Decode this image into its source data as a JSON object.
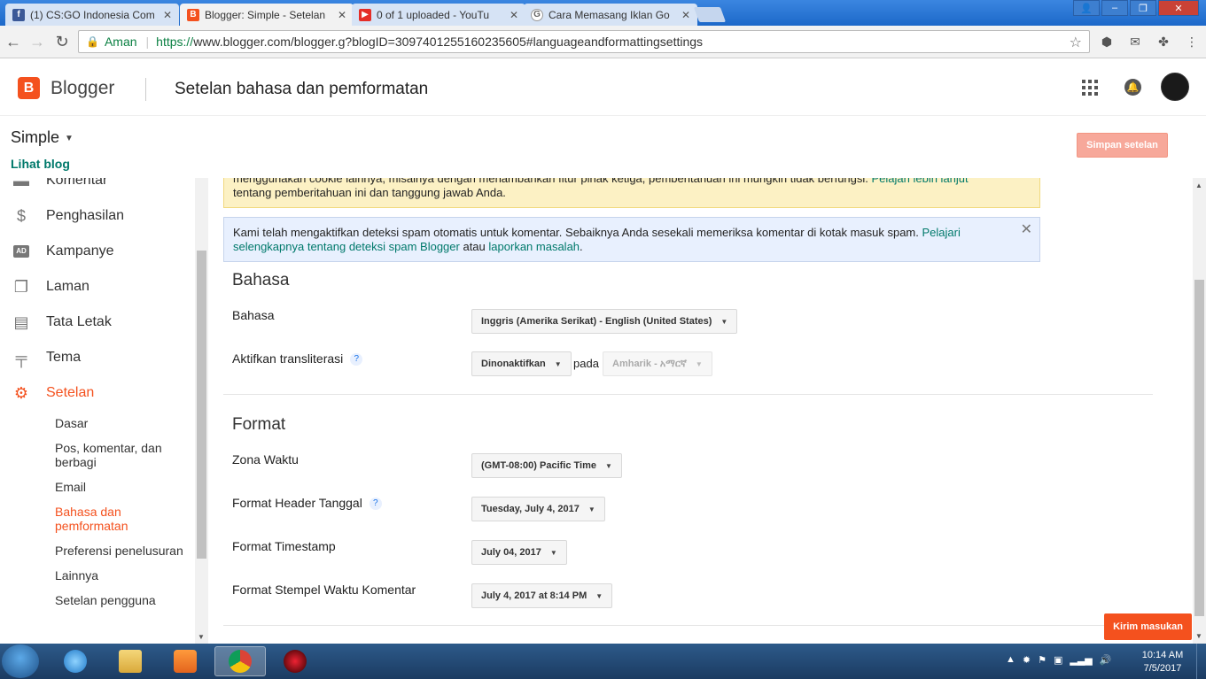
{
  "browser": {
    "tabs": [
      {
        "title": "(1) CS:GO Indonesia Com",
        "icon": "facebook-icon",
        "color": "#3b5998",
        "active": false
      },
      {
        "title": "Blogger: Simple - Setelan",
        "icon": "blogger-icon",
        "color": "#f4511e",
        "active": true
      },
      {
        "title": "0 of 1 uploaded - YouTu",
        "icon": "youtube-icon",
        "color": "#e52d27",
        "active": false
      },
      {
        "title": "Cara Memasang Iklan Go",
        "icon": "google-icon",
        "color": "#666666",
        "active": false
      }
    ],
    "secure_label": "Aman",
    "url_proto": "https://",
    "url_rest": "www.blogger.com/blogger.g?blogID=3097401255160235605#languageandformattingsettings",
    "ext_badge": "off"
  },
  "header": {
    "brand": "Blogger",
    "page_title": "Setelan bahasa dan pemformatan"
  },
  "subheader": {
    "blog_name": "Simple",
    "view_blog": "Lihat blog",
    "save_button": "Simpan setelan"
  },
  "sidebar": {
    "items": [
      {
        "label": "Komentar",
        "icon": "comment-icon"
      },
      {
        "label": "Penghasilan",
        "icon": "dollar-icon"
      },
      {
        "label": "Kampanye",
        "icon": "ad-icon"
      },
      {
        "label": "Laman",
        "icon": "pages-icon"
      },
      {
        "label": "Tata Letak",
        "icon": "layout-icon"
      },
      {
        "label": "Tema",
        "icon": "paint-roller-icon"
      },
      {
        "label": "Setelan",
        "icon": "gear-icon"
      }
    ],
    "subitems": [
      "Dasar",
      "Pos, komentar, dan berbagi",
      "Email",
      "Bahasa dan pemformatan",
      "Preferensi penelusuran",
      "Lainnya",
      "Setelan pengguna"
    ]
  },
  "notices": {
    "cookie_line1": "menggunakan cookie lainnya, misalnya dengan menambahkan fitur pihak ketiga, pemberitahuan ini mungkin tidak berfungsi.",
    "cookie_link": "Pelajari lebih lanjut",
    "cookie_line2": "tentang pemberitahuan ini dan tanggung jawab Anda.",
    "spam_text": "Kami telah mengaktifkan deteksi spam otomatis untuk komentar. Sebaiknya Anda sesekali memeriksa komentar di kotak masuk spam.",
    "spam_link1": "Pelajari selengkapnya tentang deteksi spam Blogger",
    "spam_mid": "atau",
    "spam_link2": "laporkan masalah",
    "spam_end": "."
  },
  "language": {
    "section_title": "Bahasa",
    "language_label": "Bahasa",
    "language_value": "Inggris (Amerika Serikat) - English (United States)",
    "translit_label": "Aktifkan transliterasi",
    "translit_value": "Dinonaktifkan",
    "translit_on": "pada",
    "translit_lang": "Amharik - አማርኛ",
    "help": "?"
  },
  "format": {
    "section_title": "Format",
    "timezone_label": "Zona Waktu",
    "timezone_value": "(GMT-08:00) Pacific Time",
    "date_header_label": "Format Header Tanggal",
    "date_header_value": "Tuesday, July 4, 2017",
    "timestamp_label": "Format Timestamp",
    "timestamp_value": "July 04, 2017",
    "comment_ts_label": "Format Stempel Waktu Komentar",
    "comment_ts_value": "July 4, 2017 at 8:14 PM"
  },
  "feedback_button": "Kirim masukan",
  "taskbar": {
    "time": "10:14 AM",
    "date": "7/5/2017"
  }
}
